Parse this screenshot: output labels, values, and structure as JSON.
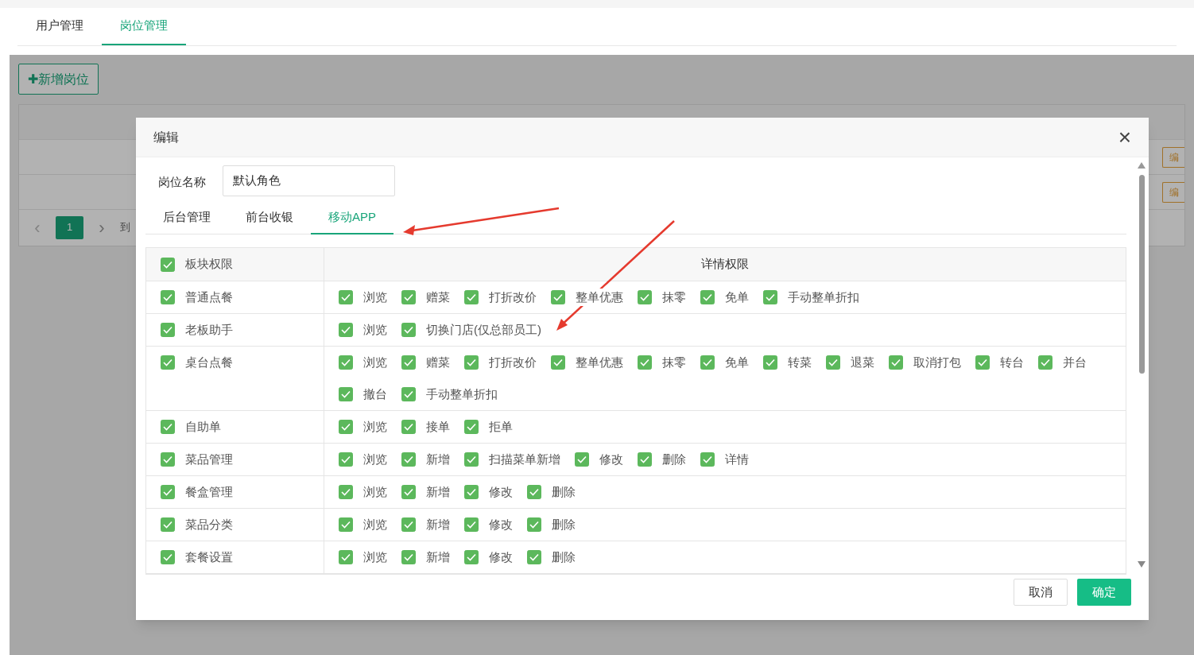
{
  "top_tabs": [
    {
      "label": "用户管理",
      "selected": false
    },
    {
      "label": "岗位管理",
      "selected": true
    }
  ],
  "add_button": "✚新增岗位",
  "pagination": {
    "prev": "‹",
    "pages": [
      {
        "label": "1",
        "selected": true
      }
    ],
    "next": "›",
    "goto": "到"
  },
  "row_buttons": [
    "编",
    "编"
  ],
  "dialog": {
    "title": "编辑",
    "close": "×",
    "name_label": "岗位名称",
    "name_value": "默认角色",
    "tabs": [
      {
        "label": "后台管理",
        "selected": false
      },
      {
        "label": "前台收银",
        "selected": false
      },
      {
        "label": "移动APP",
        "selected": true
      }
    ],
    "header": {
      "label": "板块权限",
      "checked": true
    },
    "detail_header": "详情权限",
    "modules": [
      {
        "name": "普通点餐",
        "checked": true,
        "permissions": [
          {
            "label": "浏览",
            "checked": true
          },
          {
            "label": "赠菜",
            "checked": true
          },
          {
            "label": "打折改价",
            "checked": true
          },
          {
            "label": "整单优惠",
            "checked": true
          },
          {
            "label": "抹零",
            "checked": true
          },
          {
            "label": "免单",
            "checked": true
          },
          {
            "label": "手动整单折扣",
            "checked": true
          }
        ]
      },
      {
        "name": "老板助手",
        "checked": true,
        "permissions": [
          {
            "label": "浏览",
            "checked": true
          },
          {
            "label": "切换门店(仅总部员工)",
            "checked": true
          }
        ]
      },
      {
        "name": "桌台点餐",
        "checked": true,
        "permissions": [
          {
            "label": "浏览",
            "checked": true
          },
          {
            "label": "赠菜",
            "checked": true
          },
          {
            "label": "打折改价",
            "checked": true
          },
          {
            "label": "整单优惠",
            "checked": true
          },
          {
            "label": "抹零",
            "checked": true
          },
          {
            "label": "免单",
            "checked": true
          },
          {
            "label": "转菜",
            "checked": true
          },
          {
            "label": "退菜",
            "checked": true
          },
          {
            "label": "取消打包",
            "checked": true
          },
          {
            "label": "转台",
            "checked": true
          },
          {
            "label": "并台",
            "checked": true
          },
          {
            "label": "撤台",
            "checked": true
          },
          {
            "label": "手动整单折扣",
            "checked": true
          }
        ]
      },
      {
        "name": "自助单",
        "checked": true,
        "permissions": [
          {
            "label": "浏览",
            "checked": true
          },
          {
            "label": "接单",
            "checked": true
          },
          {
            "label": "拒单",
            "checked": true
          }
        ]
      },
      {
        "name": "菜品管理",
        "checked": true,
        "permissions": [
          {
            "label": "浏览",
            "checked": true
          },
          {
            "label": "新增",
            "checked": true
          },
          {
            "label": "扫描菜单新增",
            "checked": true
          },
          {
            "label": "修改",
            "checked": true
          },
          {
            "label": "删除",
            "checked": true
          },
          {
            "label": "详情",
            "checked": true
          }
        ]
      },
      {
        "name": "餐盒管理",
        "checked": true,
        "permissions": [
          {
            "label": "浏览",
            "checked": true
          },
          {
            "label": "新增",
            "checked": true
          },
          {
            "label": "修改",
            "checked": true
          },
          {
            "label": "删除",
            "checked": true
          }
        ]
      },
      {
        "name": "菜品分类",
        "checked": true,
        "permissions": [
          {
            "label": "浏览",
            "checked": true
          },
          {
            "label": "新增",
            "checked": true
          },
          {
            "label": "修改",
            "checked": true
          },
          {
            "label": "删除",
            "checked": true
          }
        ]
      },
      {
        "name": "套餐设置",
        "checked": true,
        "permissions": [
          {
            "label": "浏览",
            "checked": true
          },
          {
            "label": "新增",
            "checked": true
          },
          {
            "label": "修改",
            "checked": true
          },
          {
            "label": "删除",
            "checked": true
          }
        ]
      }
    ],
    "buttons": [
      {
        "label": "取消",
        "kind": "secondary"
      },
      {
        "label": "确定",
        "kind": "primary"
      }
    ]
  }
}
